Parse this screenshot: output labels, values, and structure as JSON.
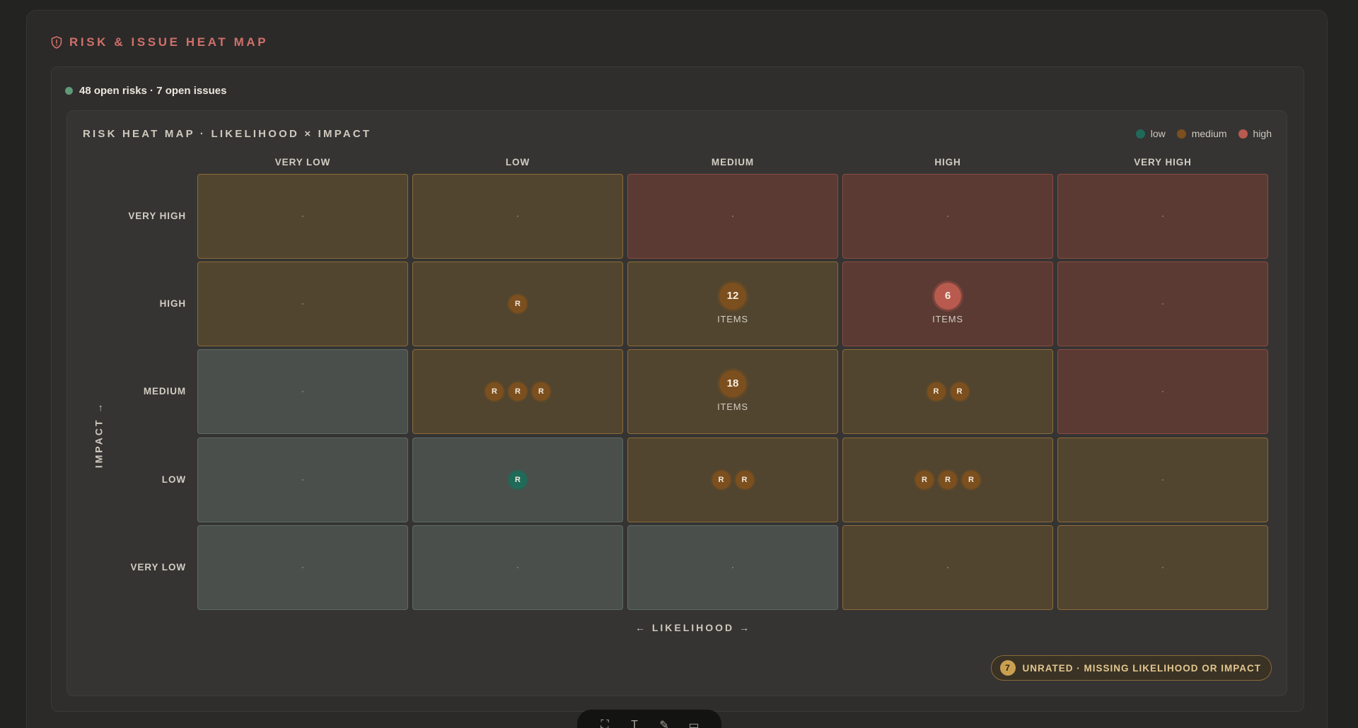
{
  "header": {
    "title": "RISK & ISSUE HEAT MAP",
    "icon": "shield-icon",
    "accent": "#d0706a"
  },
  "status": {
    "text": "48 open risks · 7 open issues",
    "dot_color": "#5f9a78"
  },
  "panel": {
    "title": "RISK HEAT MAP · LIKELIHOOD × IMPACT"
  },
  "legend": [
    {
      "label": "low",
      "color": "#1f6a59"
    },
    {
      "label": "medium",
      "color": "#7c4f1e"
    },
    {
      "label": "high",
      "color": "#b85a4e"
    }
  ],
  "axes": {
    "x_label": "← LIKELIHOOD →",
    "y_label": "IMPACT →",
    "likelihood_levels": [
      "VERY LOW",
      "LOW",
      "MEDIUM",
      "HIGH",
      "VERY HIGH"
    ],
    "impact_levels": [
      "VERY HIGH",
      "HIGH",
      "MEDIUM",
      "LOW",
      "VERY LOW"
    ]
  },
  "grid": [
    [
      {
        "severity": "medium",
        "chips": []
      },
      {
        "severity": "medium",
        "chips": []
      },
      {
        "severity": "high",
        "chips": []
      },
      {
        "severity": "high",
        "chips": []
      },
      {
        "severity": "high",
        "chips": []
      }
    ],
    [
      {
        "severity": "medium",
        "chips": []
      },
      {
        "severity": "medium",
        "chips": [
          {
            "label": "R",
            "level": "medium"
          }
        ]
      },
      {
        "severity": "medium",
        "cluster": {
          "count": "12",
          "label": "ITEMS",
          "level": "medium"
        }
      },
      {
        "severity": "high",
        "cluster": {
          "count": "6",
          "label": "ITEMS",
          "level": "high"
        }
      },
      {
        "severity": "high",
        "chips": []
      }
    ],
    [
      {
        "severity": "low",
        "chips": []
      },
      {
        "severity": "medium",
        "chips": [
          {
            "label": "R",
            "level": "medium"
          },
          {
            "label": "R",
            "level": "medium"
          },
          {
            "label": "R",
            "level": "medium"
          }
        ]
      },
      {
        "severity": "medium",
        "cluster": {
          "count": "18",
          "label": "ITEMS",
          "level": "medium"
        }
      },
      {
        "severity": "medium",
        "chips": [
          {
            "label": "R",
            "level": "medium"
          },
          {
            "label": "R",
            "level": "medium"
          }
        ]
      },
      {
        "severity": "high",
        "chips": []
      }
    ],
    [
      {
        "severity": "low",
        "chips": []
      },
      {
        "severity": "low",
        "chips": [
          {
            "label": "R",
            "level": "low"
          }
        ]
      },
      {
        "severity": "medium",
        "chips": [
          {
            "label": "R",
            "level": "medium"
          },
          {
            "label": "R",
            "level": "medium"
          }
        ]
      },
      {
        "severity": "medium",
        "chips": [
          {
            "label": "R",
            "level": "medium"
          },
          {
            "label": "R",
            "level": "medium"
          },
          {
            "label": "R",
            "level": "medium"
          }
        ]
      },
      {
        "severity": "medium",
        "chips": []
      }
    ],
    [
      {
        "severity": "low",
        "chips": []
      },
      {
        "severity": "low",
        "chips": []
      },
      {
        "severity": "low",
        "chips": []
      },
      {
        "severity": "medium",
        "chips": []
      },
      {
        "severity": "medium",
        "chips": []
      }
    ]
  ],
  "unrated": {
    "count": "7",
    "text": "UNRATED · MISSING LIKELIHOOD OR IMPACT"
  },
  "toolbar": {
    "tools": [
      {
        "icon": "select-icon",
        "glyph": "⛶"
      },
      {
        "icon": "text-icon",
        "glyph": "T"
      },
      {
        "icon": "pen-icon",
        "glyph": "✎"
      },
      {
        "icon": "comment-icon",
        "glyph": "▭"
      }
    ]
  }
}
